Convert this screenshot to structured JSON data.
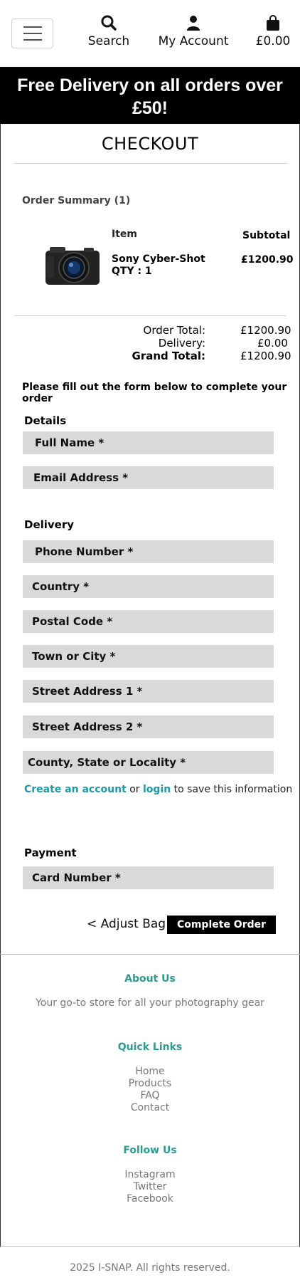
{
  "header": {
    "menu_icon": "hamburger-icon",
    "search_label": "Search",
    "search_icon": "search-icon",
    "account_label": "My Account",
    "account_icon": "user-icon",
    "bag_label": "£0.00",
    "bag_icon": "shopping-bag-icon"
  },
  "banner": {
    "text": "Free Delivery on all orders over £50!"
  },
  "checkout": {
    "title": "CHECKOUT",
    "summary_title": "Order Summary (1)",
    "col_item": "Item",
    "col_subtotal": "Subtotal",
    "product": {
      "name": "Sony Cyber-Shot",
      "qty": "QTY : 1",
      "price": "£1200.90"
    },
    "totals": {
      "order_total_label": "Order Total:",
      "order_total_value": "£1200.90",
      "delivery_label": "Delivery:",
      "delivery_value": "£0.00",
      "grand_total_label": "Grand Total:",
      "grand_total_value": "£1200.90"
    },
    "instruction": "Please fill out the form below to complete your order"
  },
  "form": {
    "details_label": "Details",
    "full_name": "Full Name *",
    "email": "Email Address *",
    "delivery_label": "Delivery",
    "phone": "Phone Number *",
    "country": "Country *",
    "postal_code": "Postal Code *",
    "town": "Town or City *",
    "street1": "Street Address 1 *",
    "street2": "Street Address 2 *",
    "county": "County, State or Locality *",
    "create_account": "Create an account",
    "or": "or",
    "login": "login",
    "save_info": "to save this information",
    "payment_label": "Payment",
    "card_number": "Card Number *",
    "adjust_bag": "< Adjust Bag",
    "complete_order": "Complete Order"
  },
  "footer": {
    "about_heading": "About Us",
    "about_text": "Your go-to store for all your photography gear",
    "quick_links_heading": "Quick Links",
    "quick_links": [
      "Home",
      "Products",
      "FAQ",
      "Contact"
    ],
    "follow_heading": "Follow Us",
    "social_links": [
      "Instagram",
      "Twitter",
      "Facebook"
    ],
    "copyright": "2025 I-SNAP. All rights reserved."
  },
  "colors": {
    "accent": "#1a9aa8",
    "field_bg": "#d9d9d9",
    "banner_bg": "#000000"
  }
}
